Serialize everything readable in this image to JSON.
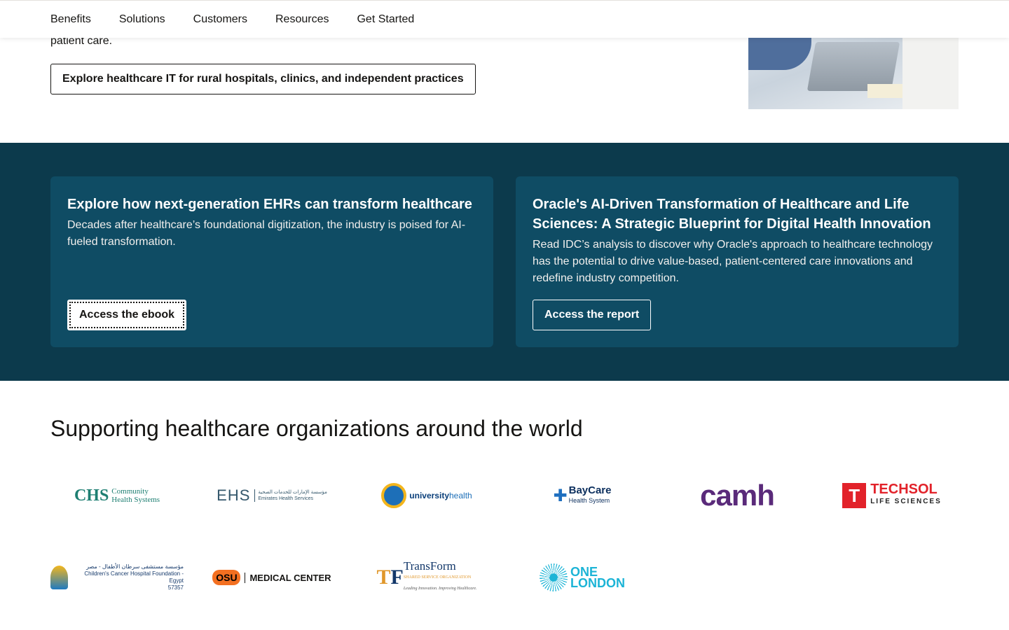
{
  "nav": {
    "items": [
      "Benefits",
      "Solutions",
      "Customers",
      "Resources",
      "Get Started"
    ]
  },
  "hero": {
    "text_tail": "patient care.",
    "button_label": "Explore healthcare IT for rural hospitals, clinics, and independent practices"
  },
  "cards": [
    {
      "title": "Explore how next-generation EHRs can transform healthcare",
      "body": "Decades after healthcare’s foundational digitization, the industry is poised for AI-fueled transformation.",
      "button_label": "Access the ebook"
    },
    {
      "title": "Oracle's AI-Driven Transformation of Healthcare and Life Sciences: A Strategic Blueprint for Digital Health Innovation",
      "body": "Read IDC’s analysis to discover why Oracle's approach to healthcare technology has the potential to drive value-based, patient-centered care innovations and redefine industry competition.",
      "button_label": "Access the report"
    }
  ],
  "customers": {
    "title": "Supporting healthcare organizations around the world",
    "logos": {
      "chs": {
        "big": "CHS",
        "line1": "Community",
        "line2": "Health Systems"
      },
      "ehs": {
        "big": "EHS",
        "arabic": "مؤسسة الإمارات للخدمات الصحية",
        "english": "Emirates Health Services"
      },
      "uh": {
        "a": "university",
        "b": "health"
      },
      "baycare": {
        "name": "BayCare",
        "sub": "Health System"
      },
      "camh": {
        "name": "camh"
      },
      "techsol": {
        "mark": "T",
        "name": "TECHSOL",
        "sub": "LIFE SCIENCES"
      },
      "ccfe": {
        "arabic": "مؤسسة مستشفى سرطان الأطفال - مصر",
        "english": "Children's Cancer Hospital Foundation - Egypt",
        "number": "57357"
      },
      "osu": {
        "mark": "OSU",
        "name": "MEDICAL CENTER"
      },
      "transform": {
        "mark_t": "T",
        "mark_f": "F",
        "name": "TransForm",
        "sub": "SHARED SERVICE ORGANIZATION",
        "tagline": "Leading Innovation. Improving Healthcare."
      },
      "onelondon": {
        "a": "ONE",
        "b": "LONDON"
      }
    }
  },
  "colors": {
    "band": "#0c3a4c",
    "card": "#0f4c64",
    "text": "#161513"
  }
}
